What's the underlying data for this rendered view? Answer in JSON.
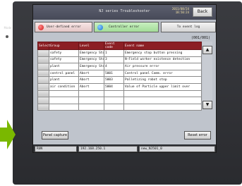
{
  "device": {
    "side_label": "Mode",
    "accent_color": "#8c1f24",
    "arrow_color": "#7ab800"
  },
  "window": {
    "title": "NJ series Troubleshooter",
    "date": "2011/08/24",
    "time": "18:50:24",
    "back_label": "Back"
  },
  "tabs": [
    {
      "label": "User-defined error",
      "icon": "red-indicator-icon"
    },
    {
      "label": "Controller error",
      "icon": "blue-indicator-icon"
    },
    {
      "label": "To event log"
    }
  ],
  "event_count": "(001/001)",
  "table": {
    "columns": [
      "Select",
      "Group",
      "Level",
      "Event code",
      "Event name"
    ],
    "rows": [
      [
        "",
        "safety",
        "Emergency Stop",
        "1",
        "Emergency stop button pressing"
      ],
      [
        "",
        "safety",
        "Emergency Stop",
        "3",
        "N-Field worker existence detection"
      ],
      [
        "",
        "plant",
        "Emergency Stop",
        "4",
        "Air pressure error"
      ],
      [
        "",
        "control panel",
        "Abort",
        "5001",
        "Control panel Comm. error"
      ],
      [
        "",
        "plant",
        "Abort",
        "5003",
        "Palletizing robot stop"
      ],
      [
        "",
        "air condition",
        "Abort",
        "5004",
        "Value of Particle upper limit over"
      ],
      [
        "",
        "",
        "",
        "",
        ""
      ],
      [
        "",
        "",
        "",
        "",
        ""
      ],
      [
        "",
        "",
        "",
        "",
        ""
      ]
    ]
  },
  "buttons": {
    "panel_capture": "Panel capture",
    "reset_error": "Reset error"
  },
  "status_bar": {
    "mode": "RUN",
    "ip": "192.168.250.1",
    "name": "new_NJ501_0"
  }
}
